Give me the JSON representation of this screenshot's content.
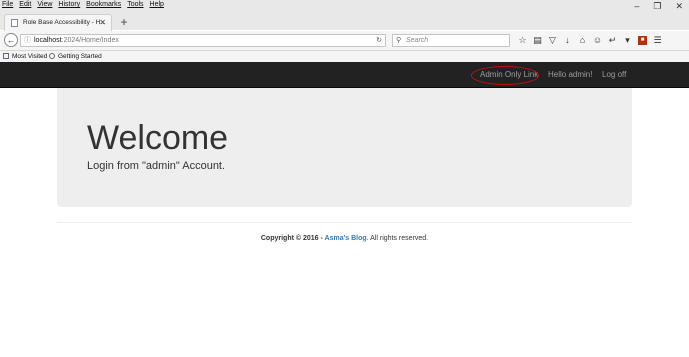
{
  "browser": {
    "menu": [
      "File",
      "Edit",
      "View",
      "History",
      "Bookmarks",
      "Tools",
      "Help"
    ],
    "tab_title": "Role Base Accessibility - H...",
    "url_host": "localhost",
    "url_rest": ":2024/Home/Index",
    "search_placeholder": "Search",
    "bookmarks": [
      "Most Visited",
      "Getting Started"
    ]
  },
  "site": {
    "nav": {
      "admin_link": "Admin Only Link",
      "hello": "Hello admin!",
      "logoff": "Log off"
    },
    "jumbotron": {
      "heading": "Welcome",
      "text": "Login from \"admin\" Account."
    },
    "footer": {
      "copyright": "Copyright © 2016 - ",
      "blog": "Asma's Blog",
      "rights": ". All rights reserved."
    },
    "annotation_color": "#c0101a"
  }
}
